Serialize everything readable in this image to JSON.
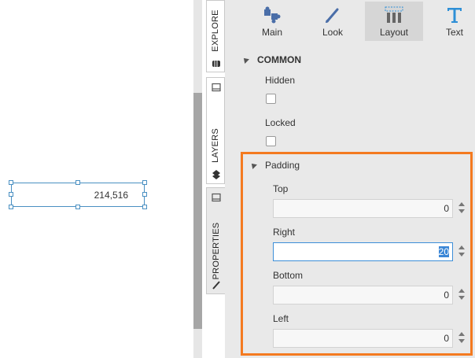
{
  "canvas": {
    "widget_value": "214,516"
  },
  "side_tabs": {
    "explore": "EXPLORE",
    "layers": "LAYERS",
    "properties": "PROPERTIES"
  },
  "toolbar": {
    "main": "Main",
    "look": "Look",
    "layout": "Layout",
    "text": "Text"
  },
  "common": {
    "title": "COMMON",
    "hidden_label": "Hidden",
    "hidden_checked": false,
    "locked_label": "Locked",
    "locked_checked": false
  },
  "padding": {
    "title": "Padding",
    "top_label": "Top",
    "top_value": "0",
    "right_label": "Right",
    "right_value": "20",
    "bottom_label": "Bottom",
    "bottom_value": "0",
    "left_label": "Left",
    "left_value": "0"
  },
  "colors": {
    "highlight": "#f47a20",
    "selection": "#3a86d6",
    "accent_blue": "#2e8fd6"
  }
}
